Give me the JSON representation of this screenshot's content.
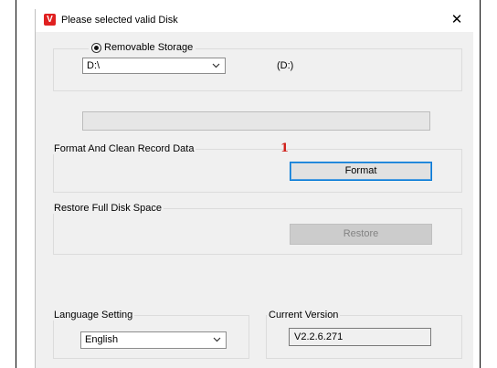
{
  "window": {
    "title": "Please selected valid Disk",
    "close_glyph": "✕",
    "app_icon_glyph": "V"
  },
  "storage": {
    "radio_label": "Removable Storage",
    "drive_selected": "D:\\",
    "drive_label": "(D:)"
  },
  "progress": {
    "value": 0
  },
  "format_section": {
    "title": "Format And Clean Record Data",
    "button_label": "Format",
    "annotation": "1"
  },
  "restore_section": {
    "title": "Restore Full Disk Space",
    "button_label": "Restore"
  },
  "language": {
    "title": "Language Setting",
    "selected": "English"
  },
  "version": {
    "title": "Current Version",
    "value": "V2.2.6.271"
  },
  "colors": {
    "accent_border": "#0078d7",
    "annotation_red": "#d0201a",
    "app_icon_red": "#e02020"
  },
  "icons": {
    "close": "close-icon",
    "app": "app-logo-icon",
    "dropdown": "chevron-down-icon"
  }
}
